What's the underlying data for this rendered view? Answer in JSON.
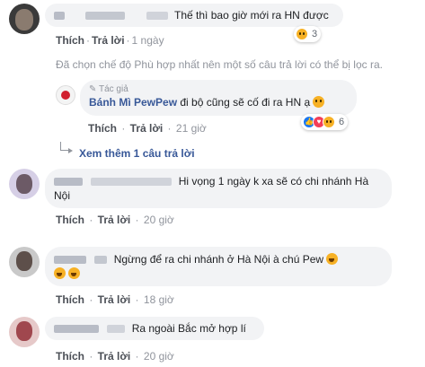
{
  "comments": [
    {
      "text": "Thế thì bao giờ mới ra HN được",
      "like": "Thích",
      "reply": "Trả lời",
      "time": "1 ngày",
      "reaction_count": "3"
    },
    {
      "text": "Hi vọng 1 ngày k xa sẽ có chi nhánh Hà",
      "text_line2": "Nội",
      "like": "Thích",
      "reply": "Trả lời",
      "time": "20 giờ"
    },
    {
      "text": "Ngừng để ra chi nhánh ở Hà Nội à chú Pew",
      "like": "Thích",
      "reply": "Trả lời",
      "time": "18 giờ"
    },
    {
      "text": "Ra ngoài Bắc mở hợp lí",
      "like": "Thích",
      "reply": "Trả lời",
      "time": "20 giờ"
    }
  ],
  "filter_notice": "Đã chọn chế độ Phù hợp nhất nên một số câu trả lời có thể bị lọc ra.",
  "reply": {
    "badge": "Tác giả",
    "author": "Bánh Mì PewPew",
    "text": "đi bộ cũng sẽ cố đi ra HN ạ",
    "like": "Thích",
    "reply": "Trả lời",
    "time": "21 giờ",
    "reaction_count": "6"
  },
  "more_replies": "Xem thêm 1 câu trả lời",
  "colors": {
    "bubble": "#f2f3f5",
    "link": "#385898",
    "meta": "#90949c"
  }
}
